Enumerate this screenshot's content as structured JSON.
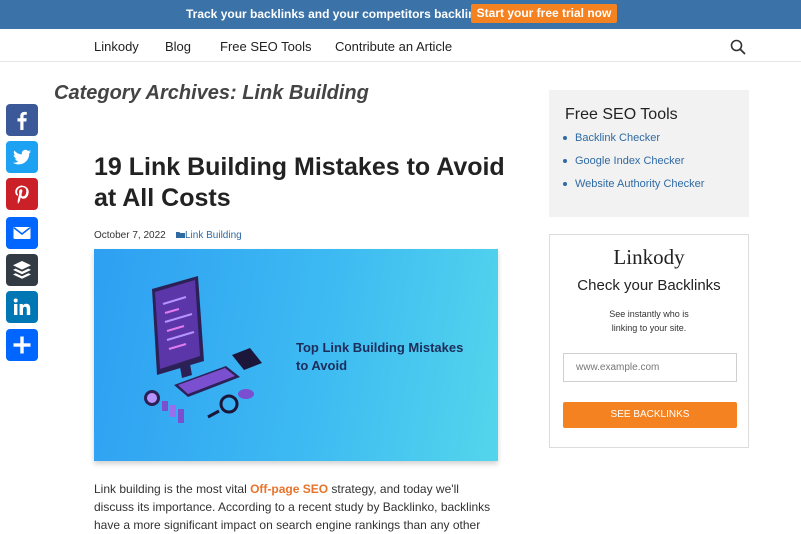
{
  "promo": {
    "text": "Track your backlinks and your competitors backlinks",
    "cta": "Start your free trial now"
  },
  "nav": {
    "items": [
      "Linkody",
      "Blog",
      "Free SEO Tools",
      "Contribute an Article"
    ],
    "search_icon": "search-icon"
  },
  "archive": {
    "title": "Category Archives: Link Building"
  },
  "share": {
    "buttons": [
      {
        "icon": "facebook-icon",
        "color": "#3b5998"
      },
      {
        "icon": "twitter-icon",
        "color": "#1da1f2"
      },
      {
        "icon": "pinterest-icon",
        "color": "#cb2027"
      },
      {
        "icon": "email-icon",
        "color": "#0166ff"
      },
      {
        "icon": "buffer-icon",
        "color": "#323b43"
      },
      {
        "icon": "linkedin-icon",
        "color": "#0077b5"
      },
      {
        "icon": "share-plus-icon",
        "color": "#0166ff"
      }
    ]
  },
  "post": {
    "title": "19 Link Building Mistakes to Avoid at All Costs",
    "date": "October 7, 2022",
    "category": "Link Building",
    "image_caption": "Top Link Building Mistakes to Avoid",
    "excerpt_before": "Link building is the most vital ",
    "excerpt_link": "Off-page SEO",
    "excerpt_after": " strategy, and today we'll discuss its importance. According to a recent study by Backlinko, backlinks have a more significant impact on search engine rankings than any other"
  },
  "sidebar": {
    "tools": {
      "title": "Free SEO Tools",
      "links": [
        "Backlink Checker",
        "Google Index Checker",
        "Website Authority Checker"
      ]
    },
    "checker": {
      "logo": "Linkody",
      "title": "Check your Backlinks",
      "subtitle": "See instantly who is linking to your site.",
      "input_placeholder": "www.example.com",
      "button": "SEE BACKLINKS"
    }
  },
  "colors": {
    "promo_bg": "#3b73a8",
    "accent": "#f58220",
    "link": "#2f6aa3"
  }
}
